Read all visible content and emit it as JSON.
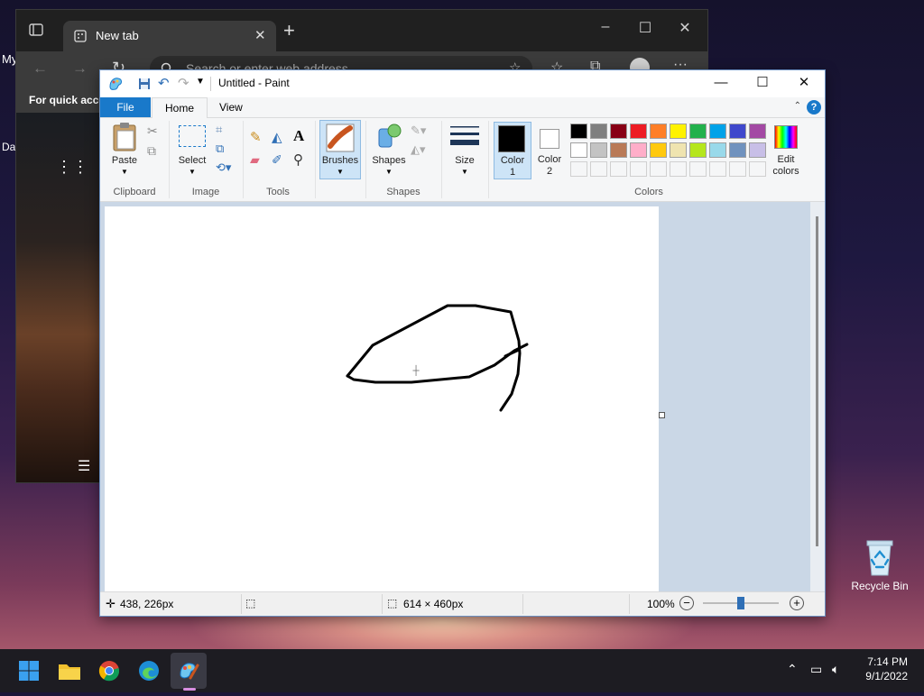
{
  "desktop": {
    "left_text": "My",
    "left_text2": "Da",
    "recycle_bin_label": "Recycle Bin"
  },
  "edge": {
    "tab_title": "New tab",
    "address_placeholder": "Search or enter web address",
    "favbar_text": "For quick acce"
  },
  "paint": {
    "title": "Untitled - Paint",
    "tabs": {
      "file": "File",
      "home": "Home",
      "view": "View"
    },
    "help": "?",
    "groups": {
      "clipboard": "Clipboard",
      "image": "Image",
      "tools": "Tools",
      "shapes": "Shapes",
      "colors": "Colors"
    },
    "buttons": {
      "paste": "Paste",
      "select": "Select",
      "brushes": "Brushes",
      "shapes": "Shapes",
      "size": "Size",
      "color1_a": "Color",
      "color1_b": "1",
      "color2_a": "Color",
      "color2_b": "2",
      "edit_colors_a": "Edit",
      "edit_colors_b": "colors",
      "text_tool": "A"
    },
    "color1": "#000000",
    "color2": "#ffffff",
    "palette_row1": [
      "#000000",
      "#7f7f7f",
      "#880015",
      "#ed1c24",
      "#ff7f27",
      "#fff200",
      "#22b14c",
      "#00a2e8",
      "#3f48cc",
      "#a349a4"
    ],
    "palette_row2": [
      "#ffffff",
      "#c3c3c3",
      "#b97a57",
      "#ffaec9",
      "#ffc90e",
      "#efe4b0",
      "#b5e61d",
      "#99d9ea",
      "#7092be",
      "#c8bfe7"
    ],
    "status": {
      "cursor_pos": "438, 226px",
      "canvas_size": "614 × 460px",
      "zoom": "100%",
      "zoom_level": 0.5
    }
  },
  "taskbar": {
    "time": "7:14 PM",
    "date": "9/1/2022"
  }
}
